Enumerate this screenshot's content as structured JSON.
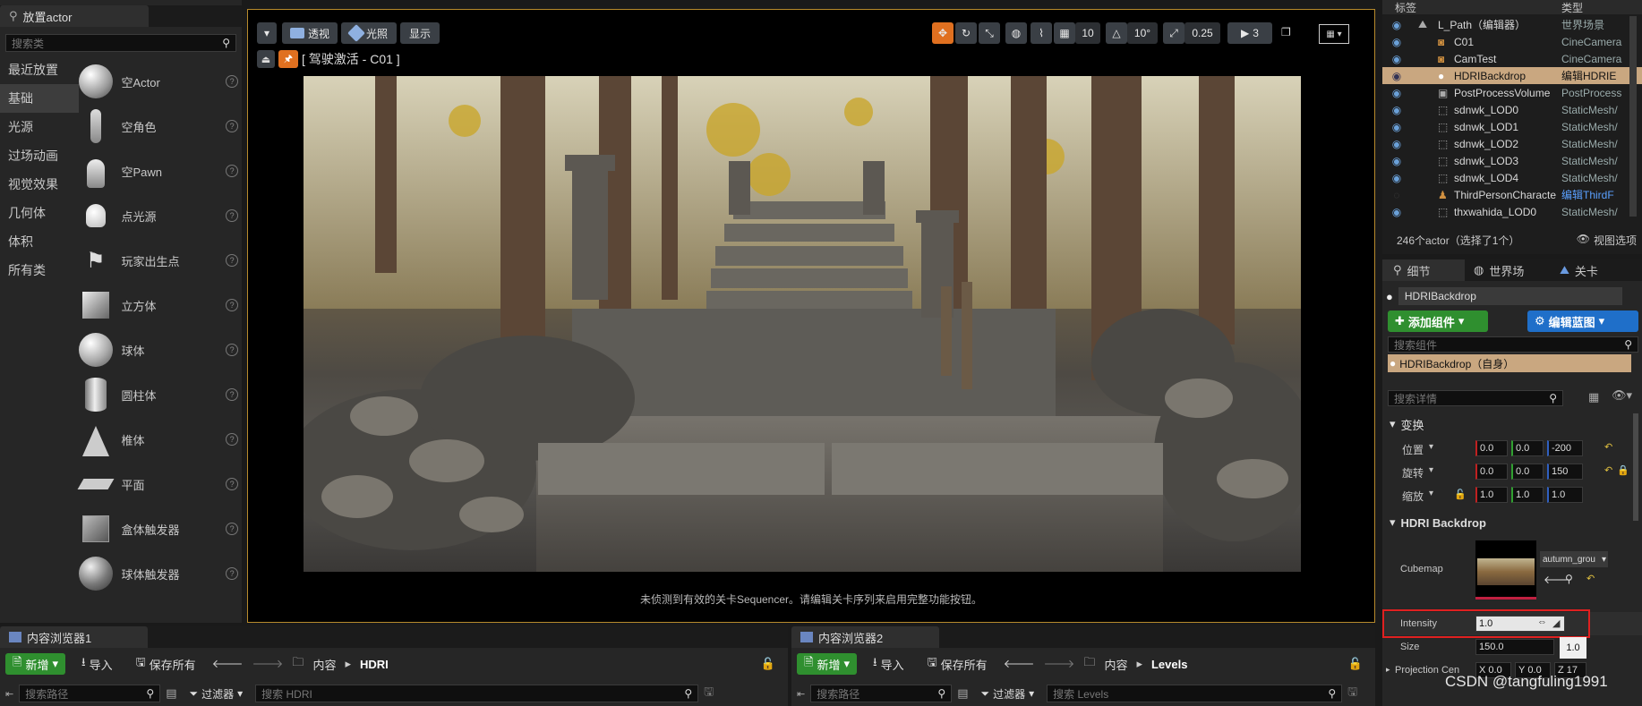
{
  "left_panel": {
    "tab_title": "放置actor",
    "search_placeholder": "搜索类",
    "categories": [
      "最近放置",
      "基础",
      "光源",
      "过场动画",
      "视觉效果",
      "几何体",
      "体积",
      "所有类"
    ],
    "items": [
      "空Actor",
      "空角色",
      "空Pawn",
      "点光源",
      "玩家出生点",
      "立方体",
      "球体",
      "圆柱体",
      "椎体",
      "平面",
      "盒体触发器",
      "球体触发器"
    ]
  },
  "viewport": {
    "perspective": "透视",
    "lit": "光照",
    "show": "显示",
    "pilot_label": "[ 驾驶激活 - C01 ]",
    "grid_value": "10",
    "rot_value": "10°",
    "scale_value": "0.25",
    "cam_speed": "3",
    "status_msg": "未侦测到有效的关卡Sequencer。请编辑关卡序列来启用完整功能按钮。"
  },
  "outliner": {
    "col_label": "标签",
    "col_type": "类型",
    "rows": [
      {
        "name": "L_Path（编辑器）",
        "type": "世界场景"
      },
      {
        "name": "C01",
        "type": "CineCamera"
      },
      {
        "name": "CamTest",
        "type": "CineCamera"
      },
      {
        "name": "HDRIBackdrop",
        "type": "编辑HDRIE"
      },
      {
        "name": "PostProcessVolume",
        "type": "PostProcess"
      },
      {
        "name": "sdnwk_LOD0",
        "type": "StaticMesh/"
      },
      {
        "name": "sdnwk_LOD1",
        "type": "StaticMesh/"
      },
      {
        "name": "sdnwk_LOD2",
        "type": "StaticMesh/"
      },
      {
        "name": "sdnwk_LOD3",
        "type": "StaticMesh/"
      },
      {
        "name": "sdnwk_LOD4",
        "type": "StaticMesh/"
      },
      {
        "name": "ThirdPersonCharacte",
        "type": "编辑ThirdF"
      },
      {
        "name": "thxwahida_LOD0",
        "type": "StaticMesh/"
      }
    ],
    "count": "246个actor（选择了1个）",
    "view_options": "视图选项"
  },
  "details": {
    "tabs": [
      "细节",
      "世界场",
      "关卡"
    ],
    "actor_name": "HDRIBackdrop",
    "add_component": "添加组件",
    "edit_blueprint": "编辑蓝图",
    "search_components": "搜索组件",
    "self_component": "HDRIBackdrop（自身）",
    "search_details": "搜索详情",
    "transform_header": "变换",
    "location_label": "位置",
    "rotation_label": "旋转",
    "scale_label": "缩放",
    "location": [
      "0.0",
      "0.0",
      "-200"
    ],
    "rotation": [
      "0.0",
      "0.0",
      "150"
    ],
    "scale": [
      "1.0",
      "1.0",
      "1.0"
    ],
    "hdri_header": "HDRI Backdrop",
    "cubemap_label": "Cubemap",
    "cubemap_value": "autumn_grou",
    "intensity_label": "Intensity",
    "intensity_value": "1.0",
    "intensity_tooltip": "1.0",
    "size_label": "Size",
    "size_value": "150.0",
    "projection_label": "Projection Cen",
    "proj_x": "0.0",
    "proj_y": "0.0",
    "proj_z": "17"
  },
  "content_browser_1": {
    "tab": "内容浏览器1",
    "new_btn": "新增",
    "import_btn": "导入",
    "save_all": "保存所有",
    "root": "内容",
    "folder": "HDRI",
    "search_path": "搜索路径",
    "filter": "过滤器",
    "search_placeholder": "搜索 HDRI"
  },
  "content_browser_2": {
    "tab": "内容浏览器2",
    "new_btn": "新增",
    "import_btn": "导入",
    "save_all": "保存所有",
    "root": "内容",
    "folder": "Levels",
    "search_path": "搜索路径",
    "filter": "过滤器",
    "search_placeholder": "搜索 Levels"
  },
  "watermark": "CSDN @tangfuling1991",
  "colors": {
    "accent_orange": "#e07020",
    "highlight_row": "#c9a780",
    "add_green": "#2f8f2f",
    "blueprint_blue": "#1f6fc9",
    "red_box": "#e02020"
  }
}
